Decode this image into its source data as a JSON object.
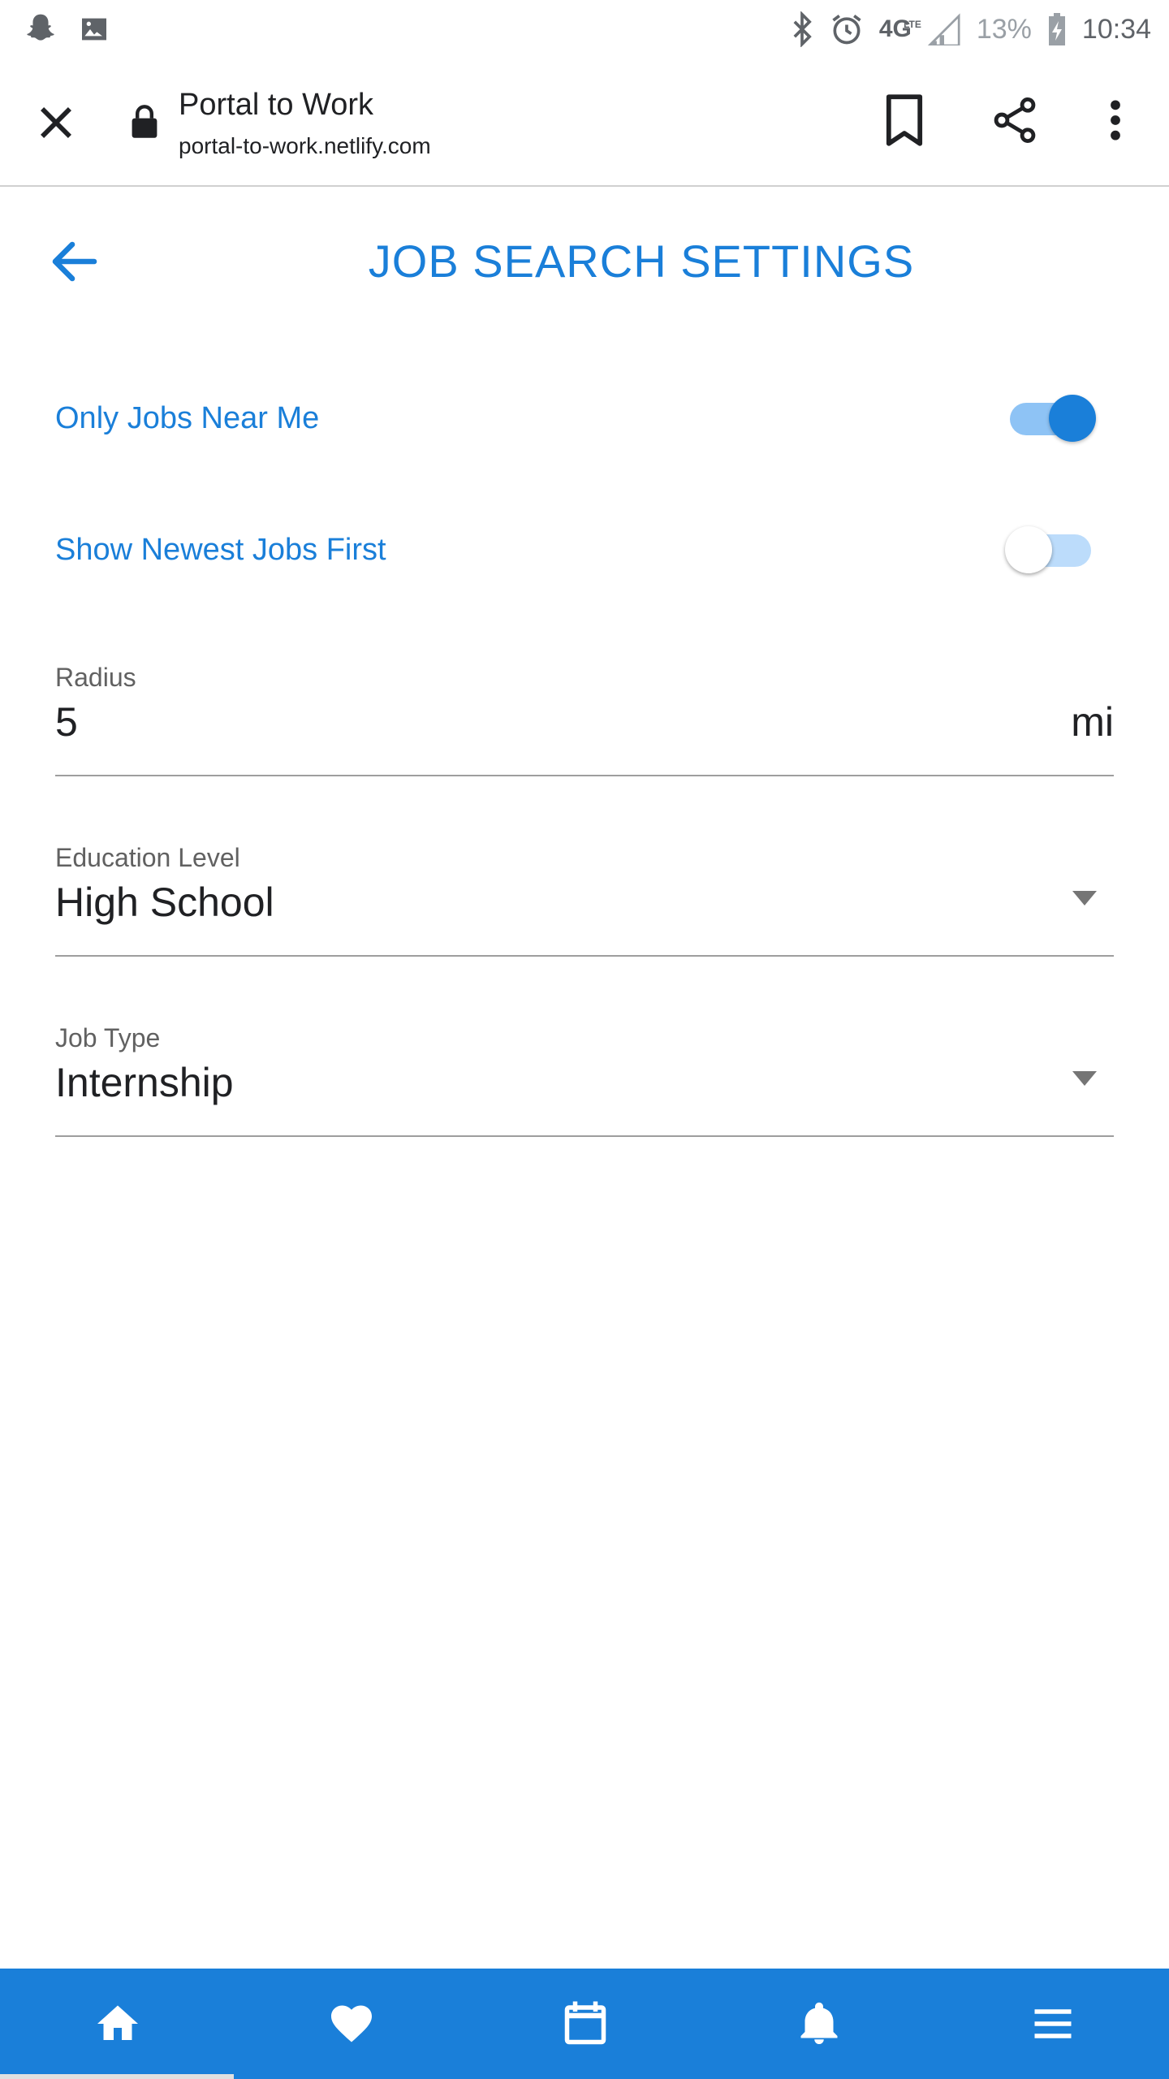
{
  "status_bar": {
    "network": "4G",
    "network_sub": "LTE",
    "battery": "13%",
    "time": "10:34"
  },
  "toolbar": {
    "title": "Portal to Work",
    "url": "portal-to-work.netlify.com"
  },
  "page": {
    "title": "JOB SEARCH SETTINGS"
  },
  "settings": {
    "near_me": {
      "label": "Only Jobs Near Me",
      "checked": true
    },
    "newest_first": {
      "label": "Show Newest Jobs First",
      "checked": false
    }
  },
  "fields": {
    "radius": {
      "label": "Radius",
      "value": "5",
      "suffix": "mi"
    },
    "education": {
      "label": "Education Level",
      "value": "High School"
    },
    "job_type": {
      "label": "Job Type",
      "value": "Internship"
    }
  },
  "bottom_nav": {
    "items": [
      "home-icon",
      "heart-icon",
      "calendar-icon",
      "bell-icon",
      "menu-icon"
    ],
    "active": "home-icon"
  },
  "colors": {
    "accent": "#1a7fd9",
    "switch_track": "#8ec3f5",
    "nav_bg": "#1a7fd9"
  }
}
